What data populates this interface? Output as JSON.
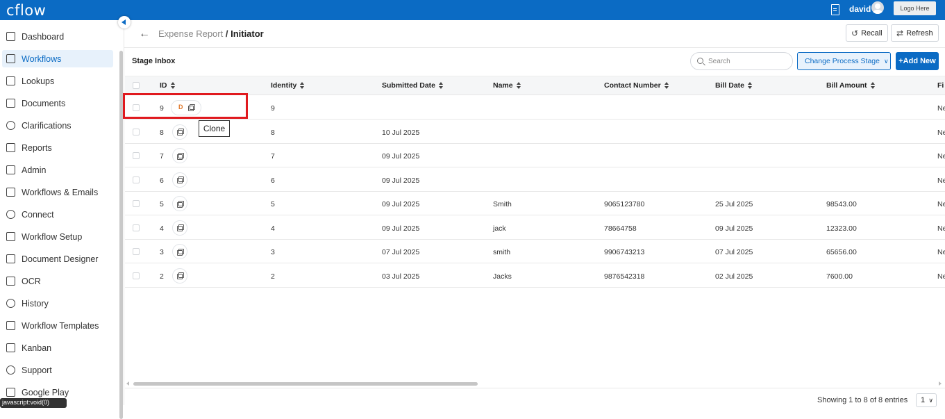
{
  "app": {
    "logo": "cflow",
    "username": "david",
    "logo_placeholder": "Logo Here"
  },
  "sidebar": {
    "items": [
      {
        "label": "Dashboard",
        "icon": "dashboard-icon"
      },
      {
        "label": "Workflows",
        "icon": "workflows-icon",
        "active": true
      },
      {
        "label": "Lookups",
        "icon": "lookups-icon"
      },
      {
        "label": "Documents",
        "icon": "documents-icon"
      },
      {
        "label": "Clarifications",
        "icon": "clarifications-icon"
      },
      {
        "label": "Reports",
        "icon": "reports-icon"
      },
      {
        "label": "Admin",
        "icon": "admin-icon"
      },
      {
        "label": "Workflows & Emails",
        "icon": "mail-icon"
      },
      {
        "label": "Connect",
        "icon": "connect-icon"
      },
      {
        "label": "Workflow Setup",
        "icon": "sliders-icon"
      },
      {
        "label": "Document Designer",
        "icon": "document-designer-icon"
      },
      {
        "label": "OCR",
        "icon": "ocr-icon"
      },
      {
        "label": "History",
        "icon": "history-icon"
      },
      {
        "label": "Workflow Templates",
        "icon": "templates-icon"
      },
      {
        "label": "Kanban",
        "icon": "kanban-icon"
      },
      {
        "label": "Support",
        "icon": "support-icon"
      },
      {
        "label": "Google Play",
        "icon": "google-play-icon"
      }
    ],
    "status_tooltip": "javascript:void(0)"
  },
  "header": {
    "breadcrumb_parent": "Expense Report",
    "breadcrumb_separator": " / ",
    "breadcrumb_current": "Initiator",
    "recall_label": "Recall",
    "refresh_label": "Refresh"
  },
  "toolbar": {
    "title": "Stage Inbox",
    "search_placeholder": "Search",
    "change_stage_label": "Change Process Stage",
    "add_new_label": "+Add New"
  },
  "table": {
    "columns": [
      "ID",
      "Identity",
      "Submitted Date",
      "Name",
      "Contact Number",
      "Bill Date",
      "Bill Amount",
      "Fi"
    ],
    "rows": [
      {
        "id": "9",
        "draft": "D",
        "identity": "9",
        "submitted": "",
        "name": "",
        "contact": "",
        "bill_date": "",
        "bill_amount": "",
        "fi": "Ne"
      },
      {
        "id": "8",
        "identity": "8",
        "submitted": "10 Jul 2025",
        "name": "",
        "contact": "",
        "bill_date": "",
        "bill_amount": "",
        "fi": "Ne"
      },
      {
        "id": "7",
        "identity": "7",
        "submitted": "09 Jul 2025",
        "name": "",
        "contact": "",
        "bill_date": "",
        "bill_amount": "",
        "fi": "Ne"
      },
      {
        "id": "6",
        "identity": "6",
        "submitted": "09 Jul 2025",
        "name": "",
        "contact": "",
        "bill_date": "",
        "bill_amount": "",
        "fi": "Ne"
      },
      {
        "id": "5",
        "identity": "5",
        "submitted": "09 Jul 2025",
        "name": "Smith",
        "contact": "9065123780",
        "bill_date": "25 Jul 2025",
        "bill_amount": "98543.00",
        "fi": "Ne"
      },
      {
        "id": "4",
        "identity": "4",
        "submitted": "09 Jul 2025",
        "name": "jack",
        "contact": "78664758",
        "bill_date": "09 Jul 2025",
        "bill_amount": "12323.00",
        "fi": "Ne"
      },
      {
        "id": "3",
        "identity": "3",
        "submitted": "07 Jul 2025",
        "name": "smith",
        "contact": "9906743213",
        "bill_date": "07 Jul 2025",
        "bill_amount": "65656.00",
        "fi": "Ne"
      },
      {
        "id": "2",
        "identity": "2",
        "submitted": "03 Jul 2025",
        "name": "Jacks",
        "contact": "9876542318",
        "bill_date": "02 Jul 2025",
        "bill_amount": "7600.00",
        "fi": "Ne"
      }
    ]
  },
  "tooltip": {
    "clone": "Clone"
  },
  "footer": {
    "entries_text": "Showing 1 to 8 of 8 entries",
    "page_size": "1"
  },
  "colors": {
    "primary": "#0b6bc4",
    "highlight": "#e0191e",
    "draft": "#e0782a"
  }
}
